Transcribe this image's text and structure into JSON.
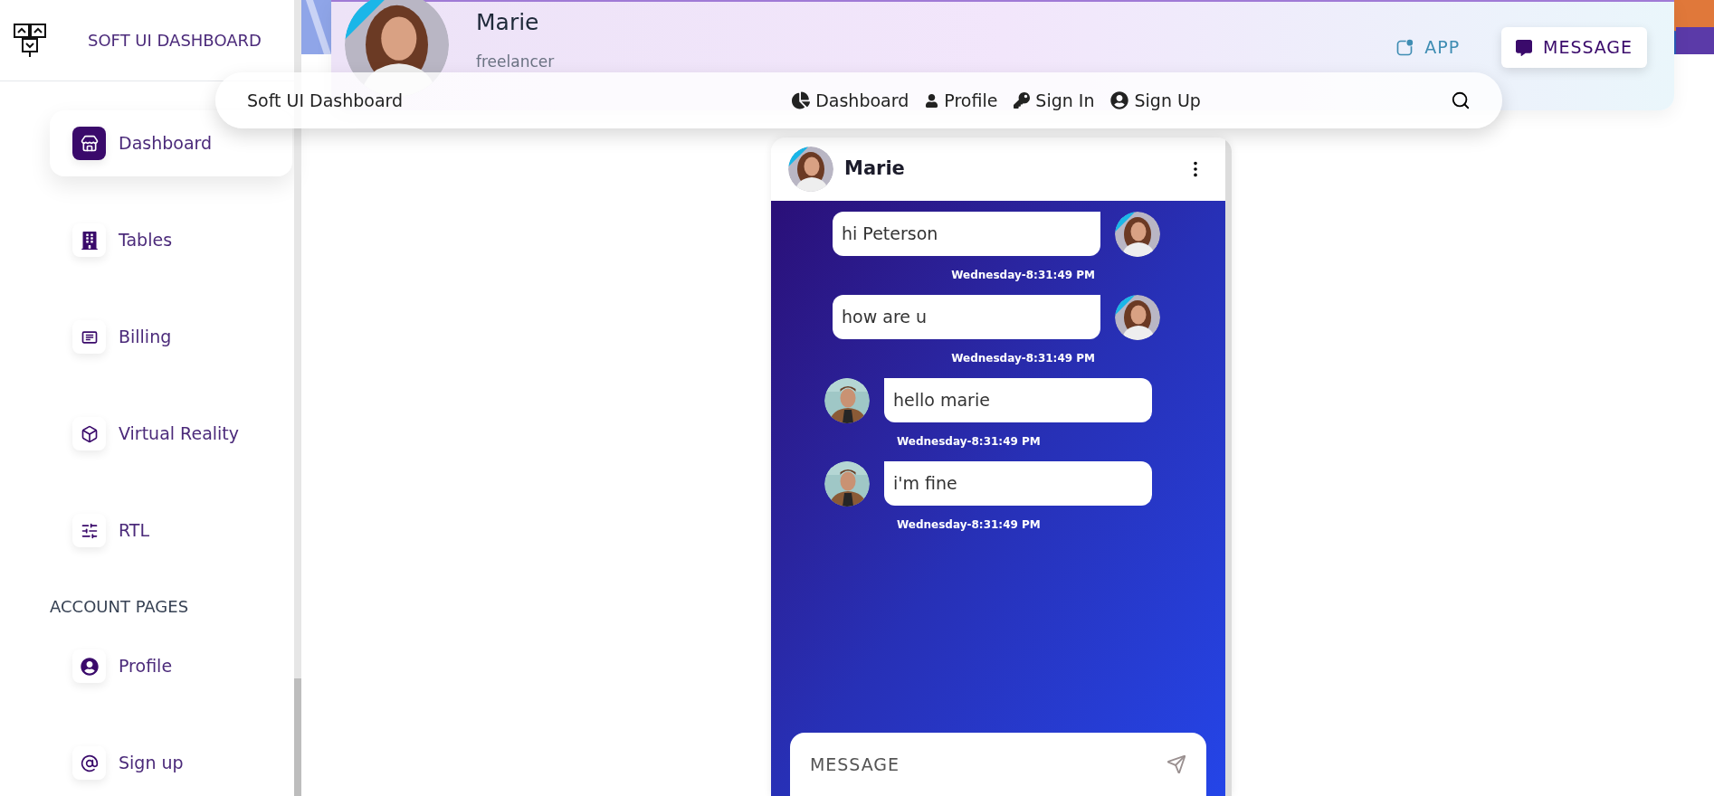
{
  "sidebar": {
    "brand": "SOFT UI DASHBOARD",
    "items": [
      {
        "label": "Dashboard",
        "selected": true
      },
      {
        "label": "Tables",
        "selected": false
      },
      {
        "label": "Billing",
        "selected": false
      },
      {
        "label": "Virtual Reality",
        "selected": false
      },
      {
        "label": "RTL",
        "selected": false
      }
    ],
    "section_title": "ACCOUNT PAGES",
    "account_items": [
      {
        "label": "Profile",
        "selected": false
      },
      {
        "label": "Sign up",
        "selected": false
      }
    ]
  },
  "navbar": {
    "brand": "Soft UI Dashboard",
    "links": [
      "Dashboard",
      "Profile",
      "Sign In",
      "Sign Up"
    ]
  },
  "profile_header": {
    "name": "Marie",
    "role": "freelancer",
    "tabs": [
      {
        "label": "APP",
        "selected": false
      },
      {
        "label": "MESSAGE",
        "selected": true
      }
    ]
  },
  "chat": {
    "contact": "Marie",
    "messages": [
      {
        "kind": "sent",
        "text": "hi Peterson",
        "time": "Wednesday-8:31:49 PM"
      },
      {
        "kind": "sent",
        "text": "how are u",
        "time": "Wednesday-8:31:49 PM"
      },
      {
        "kind": "received",
        "text": "hello marie",
        "time": "Wednesday-8:31:49 PM"
      },
      {
        "kind": "received",
        "text": "i'm fine",
        "time": "Wednesday-8:31:49 PM"
      }
    ],
    "input": {
      "placeholder": "MESSAGE"
    }
  }
}
